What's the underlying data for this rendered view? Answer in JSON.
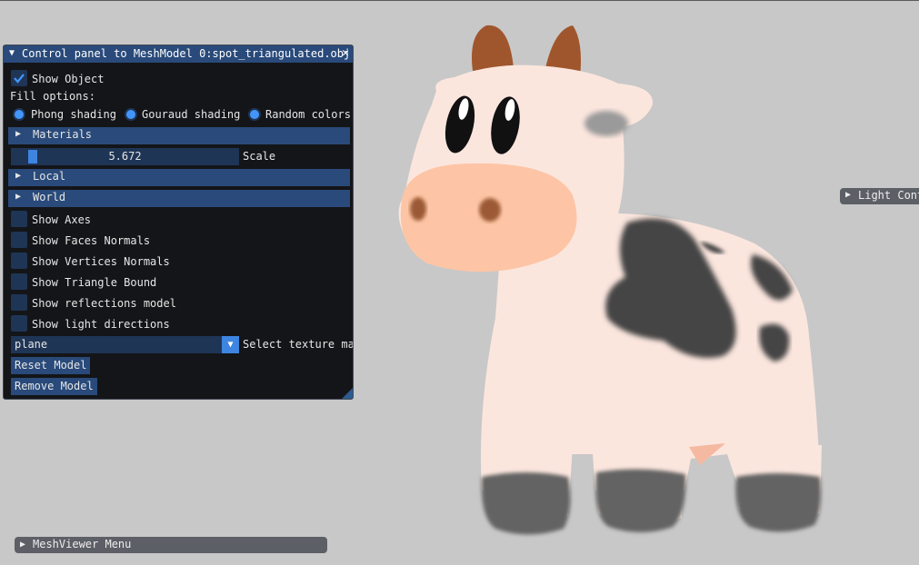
{
  "panel": {
    "title": "Control panel to MeshModel 0:spot_triangulated.obj",
    "show_object": {
      "label": "Show Object",
      "checked": true
    },
    "fill_options_label": "Fill options:",
    "fill_options": [
      {
        "label": "Phong shading"
      },
      {
        "label": "Gouraud shading"
      },
      {
        "label": "Random colors"
      }
    ],
    "sections": {
      "materials": "Materials",
      "local": "Local",
      "world": "World"
    },
    "scale": {
      "value": "5.672",
      "label": "Scale",
      "fraction": 0.08
    },
    "checkboxes": [
      {
        "label": "Show Axes",
        "checked": false
      },
      {
        "label": "Show Faces Normals",
        "checked": false
      },
      {
        "label": "Show Vertices Normals",
        "checked": false
      },
      {
        "label": "Show Triangle Bound",
        "checked": false
      },
      {
        "label": "Show reflections model",
        "checked": false
      },
      {
        "label": "Show light directions",
        "checked": false
      }
    ],
    "texture": {
      "value": "plane",
      "label": "Select texture ma"
    },
    "reset_button": "Reset Model",
    "remove_button": "Remove Model"
  },
  "light_window": {
    "title": "Light Cont"
  },
  "menu_bar": {
    "title": "MeshViewer Menu"
  },
  "colors": {
    "background": "#c8c8c8",
    "panel_bg": "#141518",
    "title_bg": "#294a7a",
    "frame_bg": "#1f3556",
    "accent": "#4296fa"
  },
  "icons": {
    "collapse": "triangle-down-icon",
    "expand": "triangle-right-icon",
    "close": "close-icon",
    "check": "checkmark-icon",
    "combo": "triangle-down-icon"
  }
}
